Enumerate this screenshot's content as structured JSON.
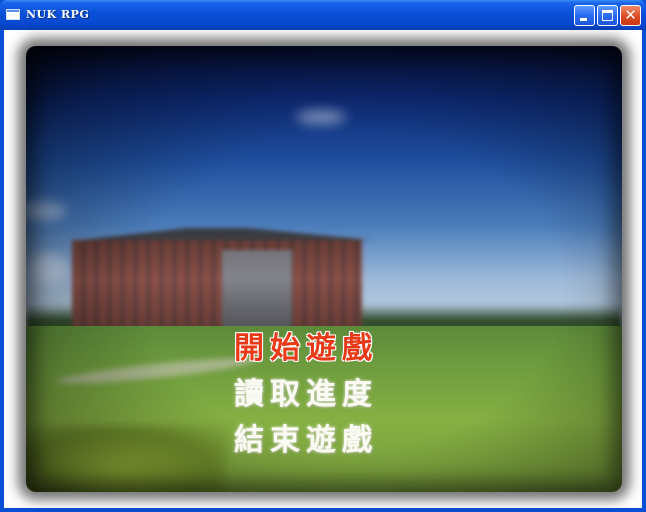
{
  "window": {
    "title": "NUK RPG",
    "icon": "app-window-icon",
    "controls": {
      "minimize_icon": "minimize-icon",
      "maximize_icon": "maximize-icon",
      "close_icon": "close-icon",
      "close_glyph": "✕"
    }
  },
  "menu": {
    "items": [
      {
        "label": "開始遊戲",
        "state": "selected",
        "color": "#e83a18"
      },
      {
        "label": "讀取進度",
        "state": "normal",
        "color": "#fbfbf4"
      },
      {
        "label": "結束遊戲",
        "state": "normal",
        "color": "#fbfbf4"
      }
    ]
  },
  "colors": {
    "titlebar": "#0a4fd8",
    "selected_item": "#e83a18",
    "normal_item": "#fbfbf4",
    "close_button": "#dc4a24"
  }
}
